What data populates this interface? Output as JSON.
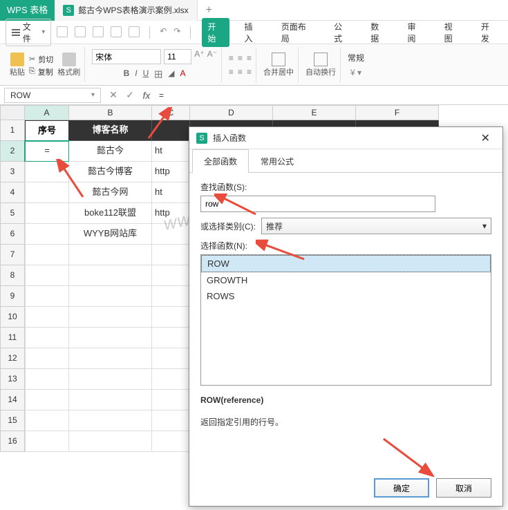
{
  "app": {
    "name": "WPS 表格",
    "tab_title": "懿古今WPS表格演示案例.xlsx",
    "icon_letter": "S"
  },
  "menu": {
    "file": "文件",
    "tabs": [
      "开始",
      "插入",
      "页面布局",
      "公式",
      "数据",
      "审阅",
      "视图",
      "开发"
    ]
  },
  "toolbar": {
    "paste": "粘贴",
    "cut": "剪切",
    "copy": "复制",
    "format_painter": "格式刷",
    "font_name": "宋体",
    "font_size": "11",
    "merge": "合并居中",
    "wrap": "自动换行",
    "normal": "常规"
  },
  "formula_bar": {
    "name_box": "ROW",
    "formula": "="
  },
  "columns": [
    "A",
    "B",
    "C",
    "D",
    "E",
    "F"
  ],
  "rows": [
    "1",
    "2",
    "3",
    "4",
    "5",
    "6",
    "7",
    "8",
    "9",
    "10",
    "11",
    "12",
    "13",
    "14",
    "15",
    "16"
  ],
  "headers": {
    "a": "序号",
    "b": "博客名称"
  },
  "data_b": [
    "懿古今",
    "懿古今博客",
    "懿古今网",
    "boke112联盟",
    "WYYB网站库"
  ],
  "data_c": [
    "ht",
    "http",
    "ht",
    "http",
    ""
  ],
  "active_cell_value": "=",
  "dialog": {
    "title": "插入函数",
    "tab_all": "全部函数",
    "tab_common": "常用公式",
    "search_label": "查找函数(S):",
    "search_value": "row",
    "category_label": "或选择类别(C):",
    "category_value": "推荐",
    "list_label": "选择函数(N):",
    "functions": [
      "ROW",
      "GROWTH",
      "ROWS"
    ],
    "syntax": "ROW(reference)",
    "description": "返回指定引用的行号。",
    "ok": "确定",
    "cancel": "取消"
  },
  "watermark": "www.yigujin.cn"
}
